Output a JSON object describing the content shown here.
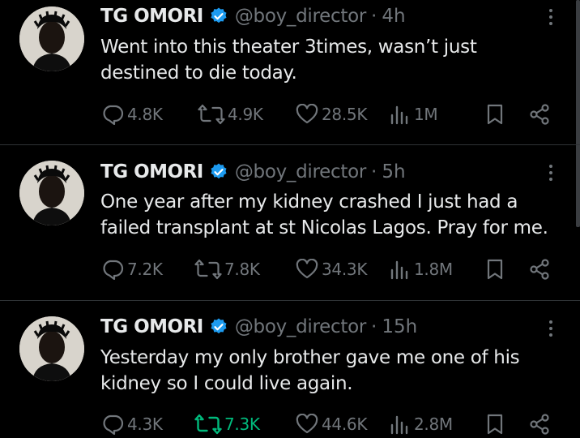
{
  "tweets": [
    {
      "author_name": "TG OMORI",
      "handle": "@boy_director",
      "separator": "·",
      "time": "4h",
      "text_lines": [
        "Went into this theater 3times, wasn’t just",
        "destined to die today."
      ],
      "replies": "4.8K",
      "reposts": "4.9K",
      "reposted": false,
      "likes": "28.5K",
      "views": "1M"
    },
    {
      "author_name": "TG OMORI",
      "handle": "@boy_director",
      "separator": "·",
      "time": "5h",
      "text_lines": [
        "One year after my kidney crashed I just had a",
        "failed transplant at st Nicolas Lagos. Pray for me."
      ],
      "replies": "7.2K",
      "reposts": "7.8K",
      "reposted": false,
      "likes": "34.3K",
      "views": "1.8M"
    },
    {
      "author_name": "TG OMORI",
      "handle": "@boy_director",
      "separator": "·",
      "time": "15h",
      "text_lines": [
        "Yesterday my only brother gave me one of his",
        "kidney so I could live again."
      ],
      "replies": "4.3K",
      "reposts": "7.3K",
      "reposted": true,
      "likes": "44.6K",
      "views": "2.8M"
    }
  ],
  "colors": {
    "background": "#000000",
    "text": "#e7e9ea",
    "secondary": "#71767b",
    "verified": "#1d9bf0",
    "repost_active": "#00ba7c",
    "divider": "#2f3336"
  }
}
